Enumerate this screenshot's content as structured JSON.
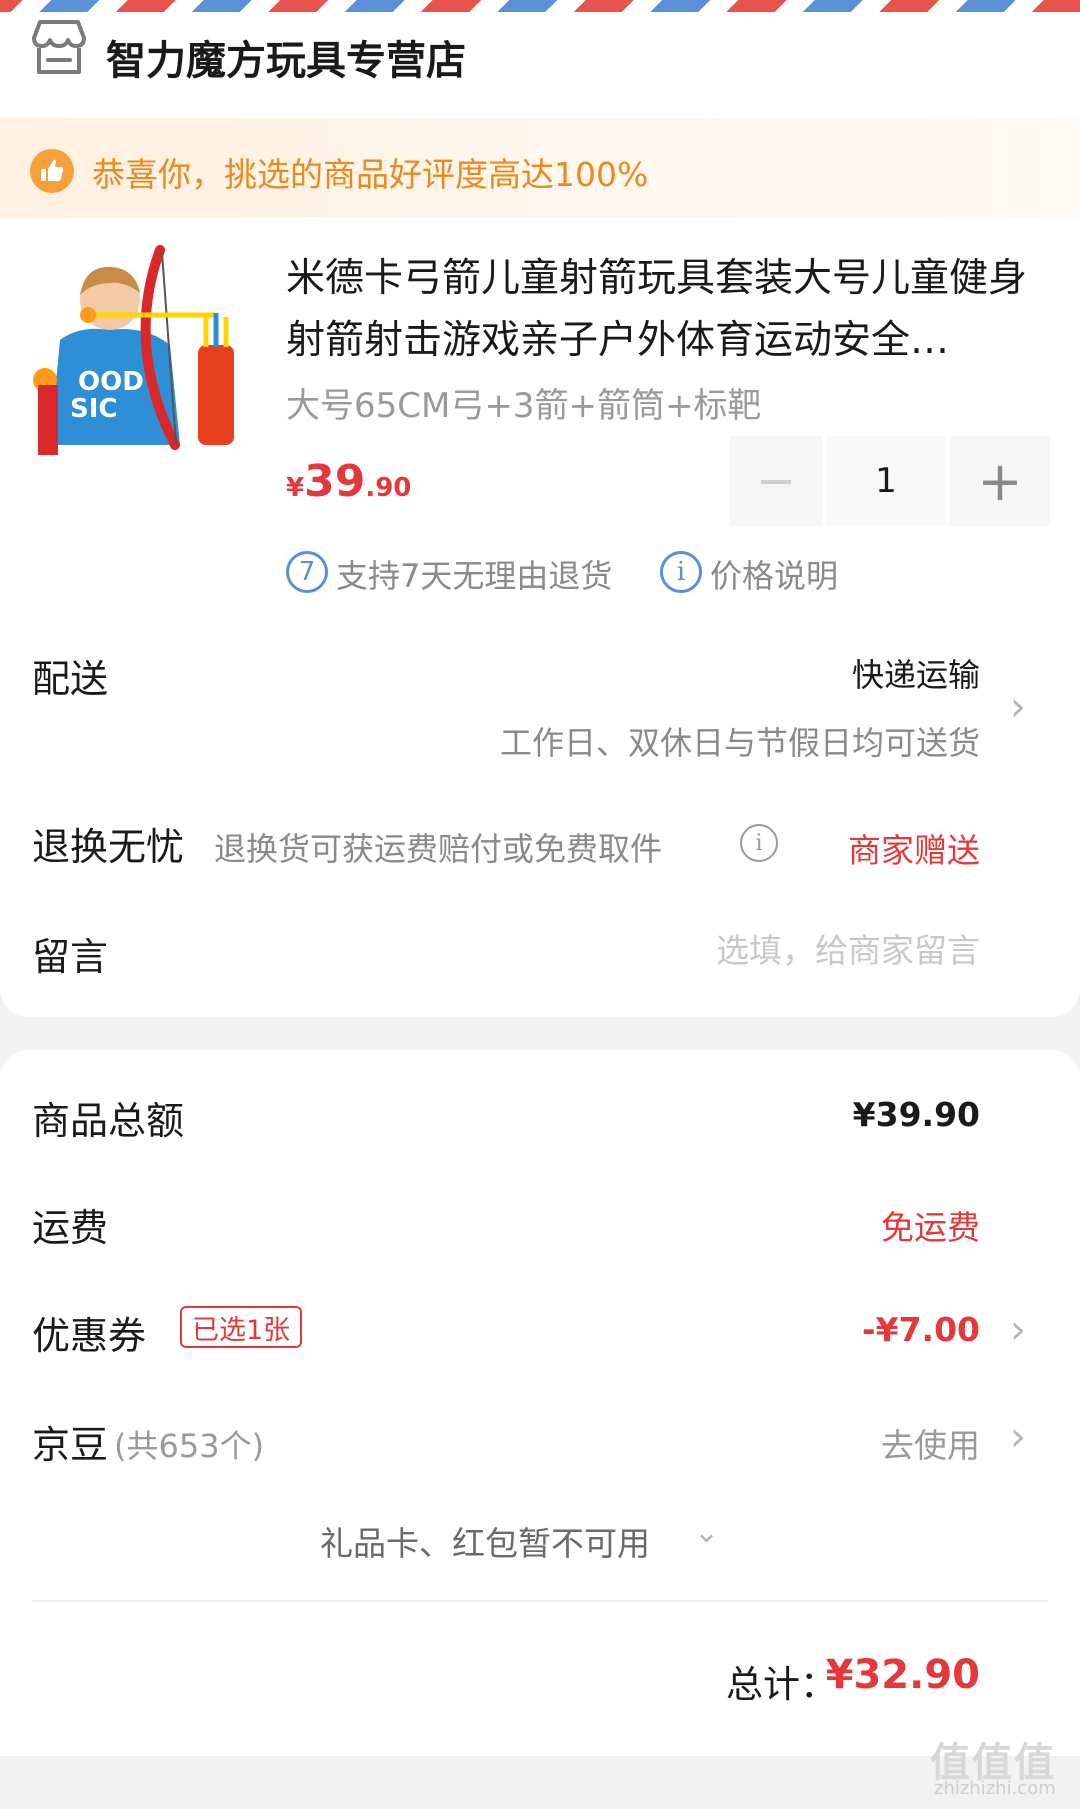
{
  "store": {
    "name": "智力魔方玩具专营店",
    "icon": "store-icon"
  },
  "banner": {
    "icon": "thumbs-up-icon",
    "text": "恭喜你，挑选的商品好评度高达100%"
  },
  "product": {
    "title": "米德卡弓箭儿童射箭玩具套装大号儿童健身射箭射击游戏亲子户外体育运动安全…",
    "spec": "大号65CM弓+3箭+箭筒+标靶",
    "price_symbol": "¥",
    "price_int": "39",
    "price_dec": ".90",
    "quantity": "1",
    "minus": "−",
    "plus": "+",
    "badge_return_num": "7",
    "badge_return_text": "支持7天无理由退货",
    "badge_price_icon": "i",
    "badge_price_text": "价格说明"
  },
  "delivery": {
    "label": "配送",
    "value": "快递运输",
    "sub": "工作日、双休日与节假日均可送货"
  },
  "returns": {
    "label": "退换无忧",
    "desc": "退换货可获运费赔付或免费取件",
    "info_icon": "i",
    "value": "商家赠送"
  },
  "note": {
    "label": "留言",
    "placeholder": "选填，给商家留言"
  },
  "summary": {
    "goods_label": "商品总额",
    "goods_value": "¥39.90",
    "shipping_label": "运费",
    "shipping_value": "免运费",
    "coupon_label": "优惠券",
    "coupon_tag": "已选1张",
    "coupon_value": "-¥7.00",
    "beans_label": "京豆",
    "beans_count": "(共653个)",
    "beans_value": "去使用",
    "gift_text": "礼品卡、红包暂不可用",
    "total_label": "总计：",
    "total_value": "¥32.90"
  },
  "chevron": "›",
  "chevron_down": "⌄",
  "watermark": {
    "text": "值值值",
    "sub": "zhizhizhi.com"
  },
  "colors": {
    "accent_red": "#e4393c",
    "banner_orange": "#e88a1e",
    "link_blue": "#5b8fd8"
  }
}
